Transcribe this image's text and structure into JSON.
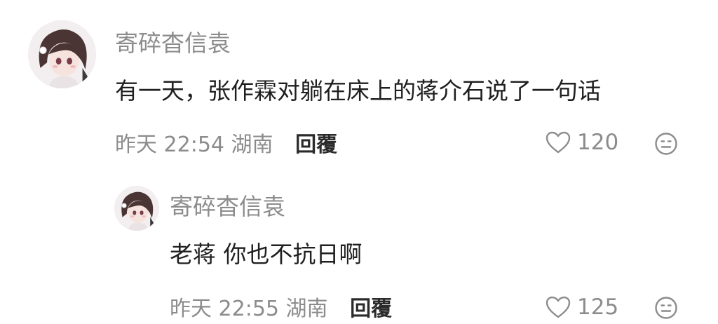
{
  "comments": [
    {
      "username": "寄碎杳信袁",
      "text": "有一天，张作霖对躺在床上的蒋介石说了一句话",
      "time": "昨天 22:54",
      "location": "湖南",
      "reply_label": "回覆",
      "likes": "120",
      "icons": {
        "like": "heart-outline-icon",
        "react": "neutral-face-icon"
      }
    },
    {
      "username": "寄碎杳信袁",
      "text": "老蒋 你也不抗日啊",
      "time": "昨天 22:55",
      "location": "湖南",
      "reply_label": "回覆",
      "likes": "125",
      "icons": {
        "like": "heart-outline-icon",
        "react": "neutral-face-icon"
      }
    }
  ],
  "colors": {
    "secondary_text": "#8c8c8c",
    "primary_text": "#1f1f1f",
    "background": "#ffffff"
  }
}
